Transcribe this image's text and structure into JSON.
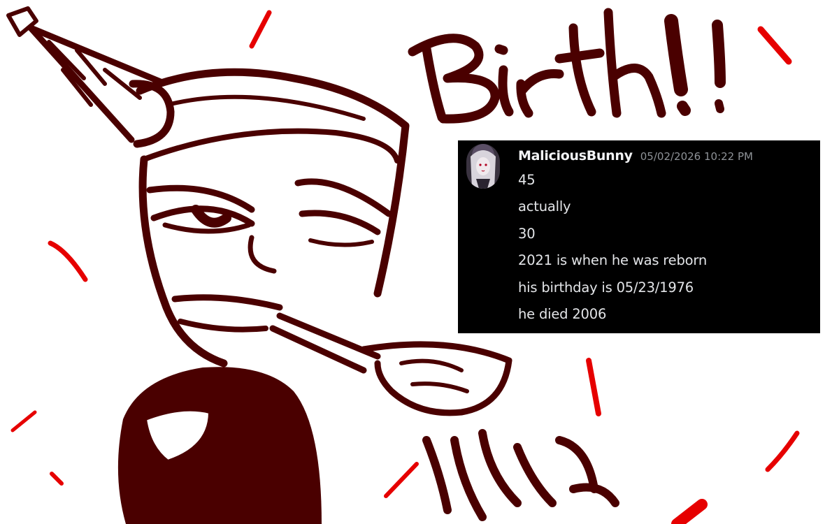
{
  "artwork": {
    "headline": "Birth!!",
    "ink_color": "#4a0000",
    "confetti_color": "#e60000"
  },
  "chat": {
    "background": "#000000",
    "username": "MaliciousBunny",
    "timestamp": "05/02/2026 10:22 PM",
    "messages": [
      "45",
      "actually",
      "30",
      "2021 is when he was reborn",
      "his birthday is 05/23/1976",
      "he died 2006"
    ]
  }
}
